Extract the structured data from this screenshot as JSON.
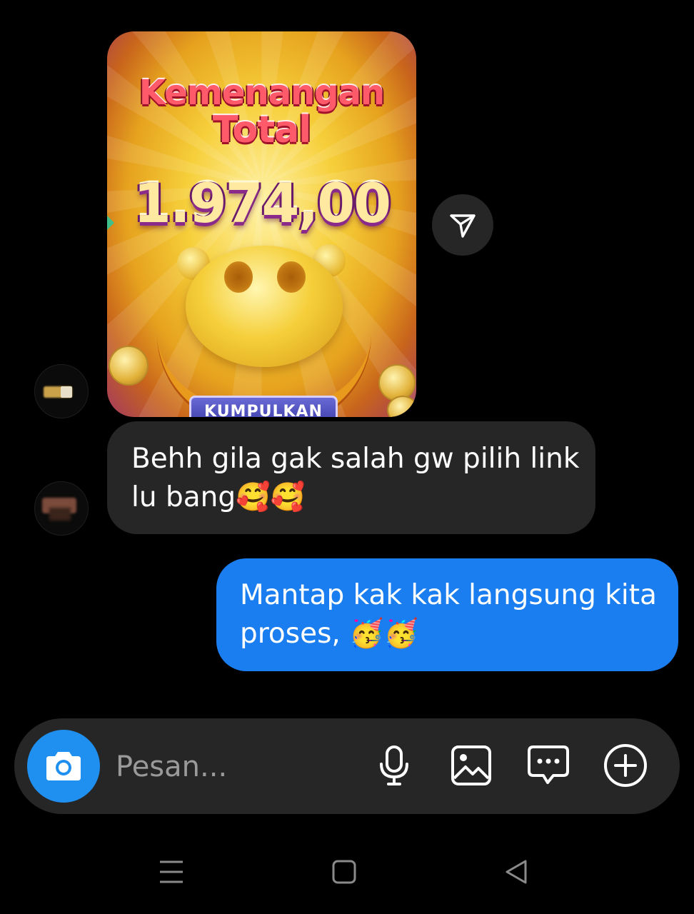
{
  "shared_post": {
    "title_line1": "Kemenangan",
    "title_line2": "Total",
    "amount": "1.974,00",
    "button_label": "KUMPULKAN"
  },
  "messages": [
    {
      "direction": "incoming",
      "line1": "Behh gila gak salah gw pilih link",
      "line2": "lu bang🥰🥰"
    },
    {
      "direction": "outgoing",
      "line1": "Mantap kak kak langsung kita",
      "line2": "proses, 🥳🥳"
    }
  ],
  "composer": {
    "placeholder": "Pesan..."
  },
  "icons": {
    "share": "share-send-icon",
    "camera": "camera-icon",
    "mic": "microphone-icon",
    "gallery": "gallery-icon",
    "sticker": "chat-bubble-icon",
    "add": "add-circle-icon",
    "nav_menu": "menu-icon",
    "nav_home": "home-square-icon",
    "nav_back": "back-triangle-icon"
  },
  "colors": {
    "background": "#000000",
    "incoming_bubble": "#262626",
    "outgoing_bubble": "#1a7ef0",
    "camera_button": "#1f8ff0"
  }
}
